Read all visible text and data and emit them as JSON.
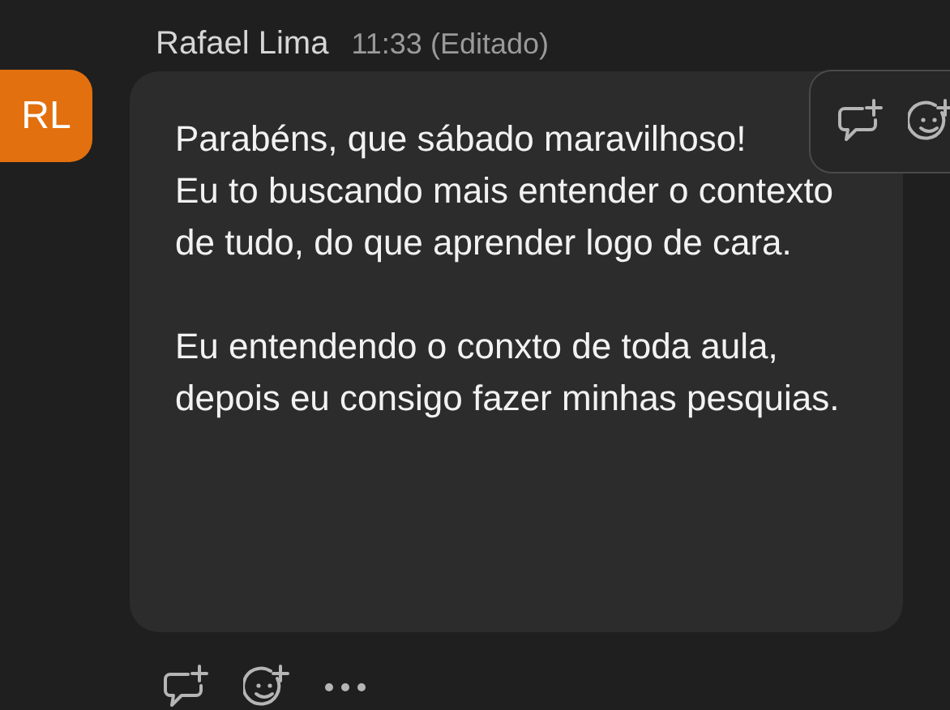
{
  "message": {
    "author": "Rafael Lima",
    "avatar_initials": "RL",
    "time": "11:33",
    "edited_label": "(Editado)",
    "paragraphs": [
      "Parabéns, que sábado maravilhoso!\nEu to buscando mais entender o contexto de tudo, do que aprender logo de cara.",
      "Eu entendendo o conxto de toda aula, depois eu consigo fazer minhas pesquias."
    ]
  }
}
